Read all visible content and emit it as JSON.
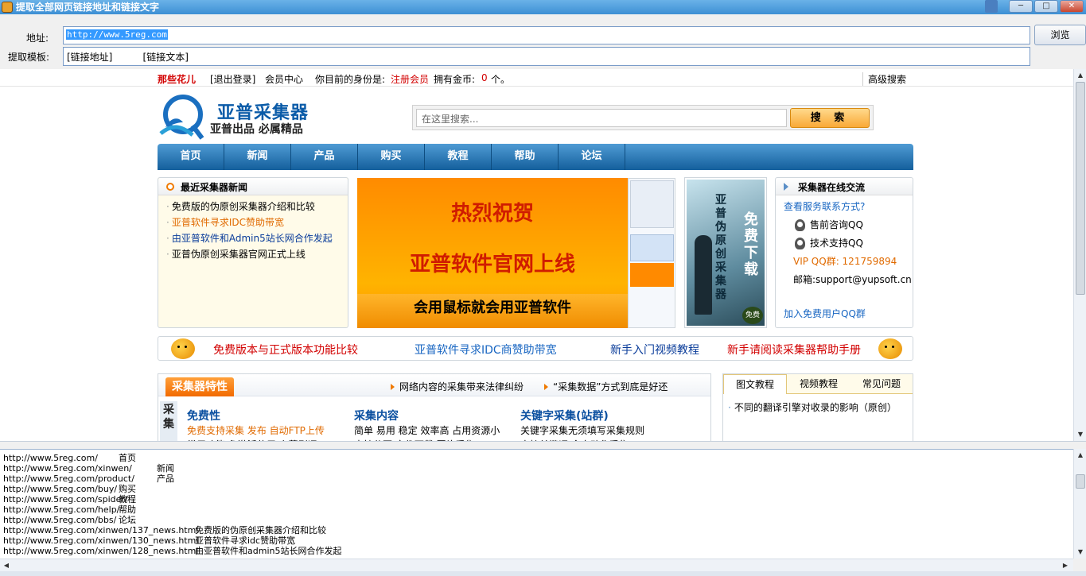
{
  "window": {
    "title": "提取全部网页链接地址和链接文字",
    "minimize": "─",
    "maximize": "□",
    "close": "✕"
  },
  "toolbar": {
    "address_label": "地址:",
    "address_value": "http://www.5reg.com",
    "template_label": "提取模板:",
    "template_value": "[链接地址]          [链接文本]",
    "browse_label": "浏览"
  },
  "site": {
    "topbar": {
      "username": "那些花儿",
      "logout": "[退出登录]",
      "member_center": "会员中心",
      "identity_prefix": "你目前的身份是:",
      "identity_value": "注册会员",
      "coins_prefix": "拥有金币:",
      "coins_value": "0",
      "coins_suffix": "个。",
      "advanced_search": "高级搜索"
    },
    "logo": {
      "name": "亚普采集器",
      "slogan": "亚普出品 必属精品"
    },
    "search": {
      "placeholder": "在这里搜索...",
      "button": "搜 索"
    },
    "nav": [
      "首页",
      "新闻",
      "产品",
      "购买",
      "教程",
      "帮助",
      "论坛"
    ],
    "news": {
      "title": "最近采集器新闻",
      "items": [
        {
          "text": "免费版的伪原创采集器介绍和比较",
          "color": "#000000"
        },
        {
          "text": "亚普软件寻求IDC赞助带宽",
          "color": "#e06a00"
        },
        {
          "text": "由亚普软件和Admin5站长网合作发起",
          "color": "#0a3c9a"
        },
        {
          "text": "亚普伪原创采集器官网正式上线",
          "color": "#000000"
        }
      ]
    },
    "banner": {
      "line1": "热烈祝贺",
      "line2": "亚普软件官网上线",
      "line3": "会用鼠标就会用亚普软件"
    },
    "ad": {
      "vertical1": "亚普伪原创采集器",
      "vertical2": "免费下载",
      "badge": "免费"
    },
    "chat": {
      "title": "采集器在线交流",
      "contact": "查看服务联系方式?",
      "presale_qq": "售前咨询QQ",
      "tech_qq": "技术支持QQ",
      "vip_group": "VIP QQ群: 121759894",
      "email": "邮箱:support@yupsoft.cn",
      "free_group": "加入免费用户QQ群"
    },
    "links": [
      {
        "text": "免费版本与正式版本功能比较",
        "color": "#d20000"
      },
      {
        "text": "亚普软件寻求IDC商赞助带宽",
        "color": "#1866c2"
      },
      {
        "text": "新手入门视频教程",
        "color": "#0a3c9a"
      },
      {
        "text": "新手请阅读采集器帮助手册",
        "color": "#d20000"
      }
    ],
    "features": {
      "tag": "采集器特性",
      "head_links": [
        "网络内容的采集带来法律纠纷",
        "“采集数据”方式到底是好还"
      ],
      "side_label": "采集",
      "columns": [
        {
          "title": "免费性",
          "text": "免费支持采集 发布 自动FTP上传",
          "text_color": "#e06a00",
          "text2": "常用功能 免激活使用 上萬刷评"
        },
        {
          "title": "采集内容",
          "text": "简单 易用 稳定 效率高 占用资源小",
          "text_color": "#222222",
          "text2": "支持分页 文件下载 图片采集"
        },
        {
          "title": "关键字采集(站群)",
          "text": "关键字采集无须填写采集规则",
          "text_color": "#222222",
          "text2": "直接关键词 全自动化采集"
        }
      ]
    },
    "tabs": {
      "items": [
        "图文教程",
        "视频教程",
        "常见问题"
      ],
      "active": "图文教程",
      "entry": "不同的翻译引擎对收录的影响（原创）"
    }
  },
  "output": {
    "rows": [
      {
        "url": "http://www.5reg.com/",
        "text": "首页",
        "text_offset": 145
      },
      {
        "url": "http://www.5reg.com/xinwen/",
        "text": "新闻",
        "text_offset": 193
      },
      {
        "url": "http://www.5reg.com/product/",
        "text": "产品",
        "text_offset": 193
      },
      {
        "url": "http://www.5reg.com/buy/",
        "text": "购买",
        "text_offset": 145
      },
      {
        "url": "http://www.5reg.com/spider/",
        "text": "教程",
        "text_offset": 145
      },
      {
        "url": "http://www.5reg.com/help/",
        "text": "帮助",
        "text_offset": 145
      },
      {
        "url": "http://www.5reg.com/bbs/",
        "text": "论坛",
        "text_offset": 145
      },
      {
        "url": "http://www.5reg.com/xinwen/137_news.html",
        "text": "免费版的伪原创采集器介绍和比较",
        "text_offset": 241
      },
      {
        "url": "http://www.5reg.com/xinwen/130_news.html",
        "text": "亚普软件寻求idc赞助带宽",
        "text_offset": 241
      },
      {
        "url": "http://www.5reg.com/xinwen/128_news.html",
        "text": "由亚普软件和admin5站长网合作发起",
        "text_offset": 241
      }
    ]
  }
}
